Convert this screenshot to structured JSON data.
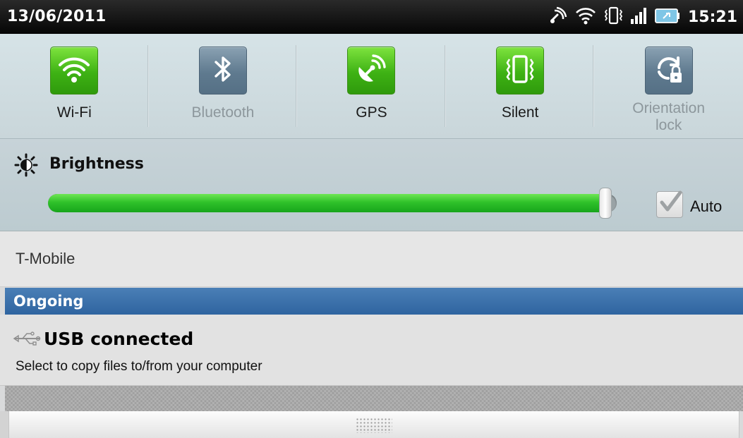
{
  "status_bar": {
    "date": "13/06/2011",
    "time": "15:21",
    "icons": [
      "nfc-icon",
      "wifi-icon",
      "vibrate-icon",
      "signal-icon",
      "battery-icon"
    ]
  },
  "toggles": [
    {
      "label": "Wi-Fi",
      "state": "on",
      "icon": "wifi-icon"
    },
    {
      "label": "Bluetooth",
      "state": "off",
      "icon": "bluetooth-icon"
    },
    {
      "label": "GPS",
      "state": "on",
      "icon": "gps-icon"
    },
    {
      "label": "Silent",
      "state": "on",
      "icon": "vibrate-icon"
    },
    {
      "label": "Orientation\nlock",
      "label_lines": [
        "Orientation",
        "lock"
      ],
      "state": "off",
      "icon": "orientation-lock-icon"
    }
  ],
  "brightness": {
    "title": "Brightness",
    "level": 0.99,
    "auto_label": "Auto",
    "auto_checked": true
  },
  "carrier": "T-Mobile",
  "ongoing": {
    "header": "Ongoing",
    "notification": {
      "title": "USB connected",
      "text": "Select to copy files to/from your computer",
      "icon": "usb-icon"
    }
  },
  "colors": {
    "toggle_on": "#3eb214",
    "toggle_off": "#5f7a8f",
    "slider_fill": "#2fc22a",
    "ongoing_header": "#2f64a0"
  }
}
